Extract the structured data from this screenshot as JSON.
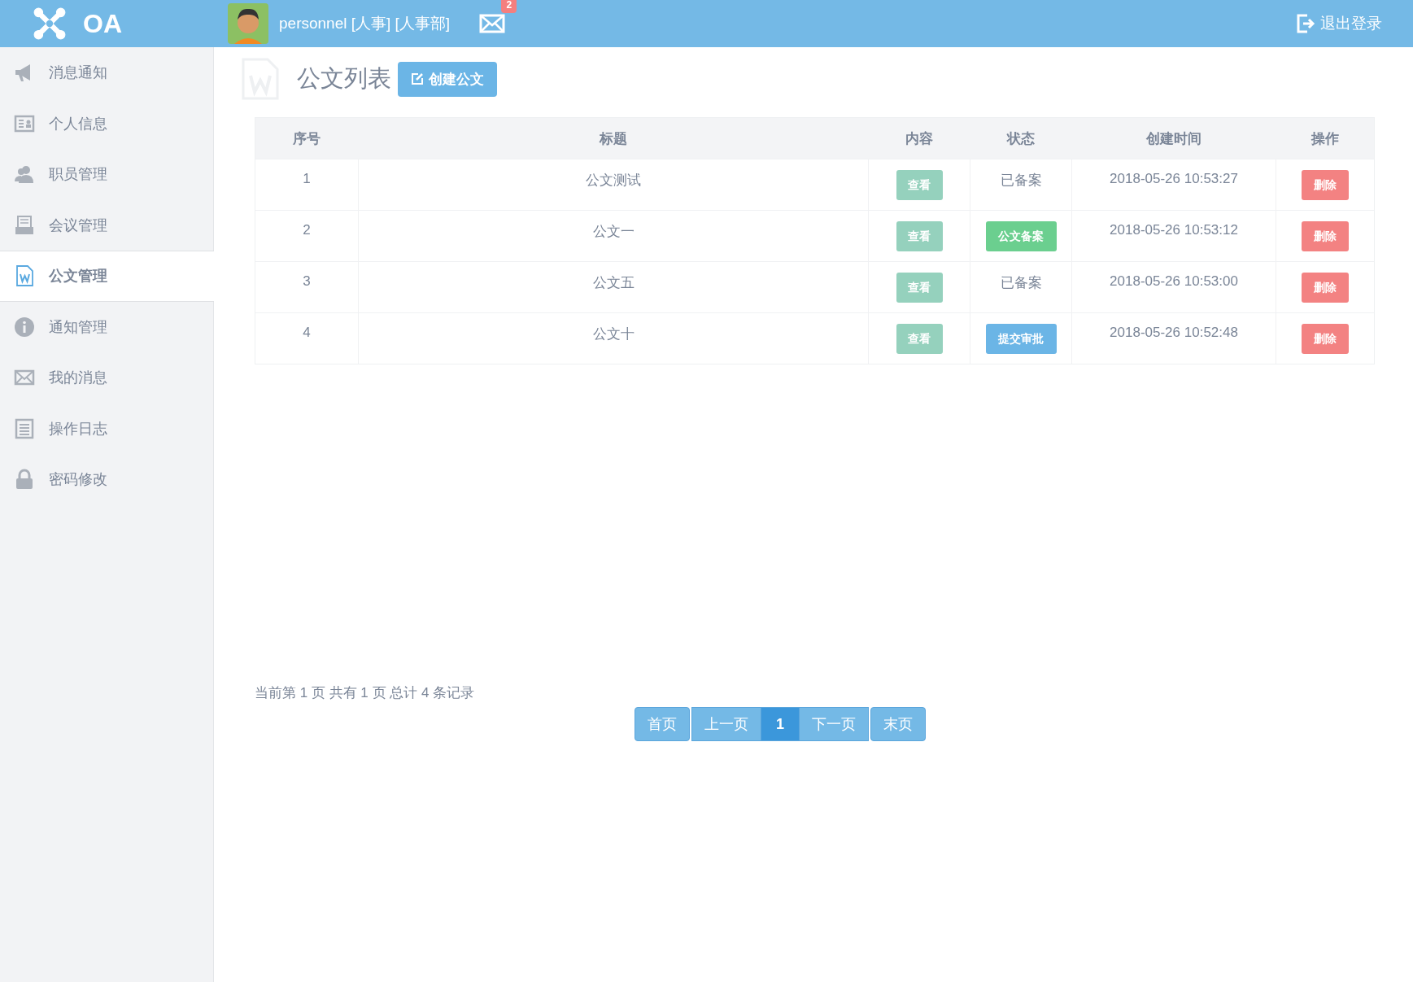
{
  "header": {
    "logo_text": "OA",
    "user": "personnel [人事] [人事部]",
    "mail_badge": "2",
    "logout": "退出登录"
  },
  "sidebar": {
    "items": [
      {
        "label": "消息通知",
        "selected": false
      },
      {
        "label": "个人信息",
        "selected": false
      },
      {
        "label": "职员管理",
        "selected": false
      },
      {
        "label": "会议管理",
        "selected": false
      },
      {
        "label": "公文管理",
        "selected": true
      },
      {
        "label": "通知管理",
        "selected": false
      },
      {
        "label": "我的消息",
        "selected": false
      },
      {
        "label": "操作日志",
        "selected": false
      },
      {
        "label": "密码修改",
        "selected": false
      }
    ]
  },
  "page": {
    "title": "公文列表",
    "create_button": "创建公文"
  },
  "table": {
    "columns": [
      "序号",
      "标题",
      "内容",
      "状态",
      "创建时间",
      "操作"
    ],
    "rows": [
      {
        "index": "1",
        "title": "公文测试",
        "view": "查看",
        "status": {
          "kind": "text",
          "label": "已备案"
        },
        "created": "2018-05-26 10:53:27",
        "delete": "删除"
      },
      {
        "index": "2",
        "title": "公文一",
        "view": "查看",
        "status": {
          "kind": "button",
          "label": "公文备案",
          "color": "#6bcf8f"
        },
        "created": "2018-05-26 10:53:12",
        "delete": "删除"
      },
      {
        "index": "3",
        "title": "公文五",
        "view": "查看",
        "status": {
          "kind": "text",
          "label": "已备案"
        },
        "created": "2018-05-26 10:53:00",
        "delete": "删除"
      },
      {
        "index": "4",
        "title": "公文十",
        "view": "查看",
        "status": {
          "kind": "button",
          "label": "提交审批",
          "color": "#6bb5e6"
        },
        "created": "2018-05-26 10:52:48",
        "delete": "删除"
      }
    ]
  },
  "pagination": {
    "summary": "当前第 1 页 共有 1 页 总计 4 条记录",
    "buttons": [
      {
        "label": "首页",
        "selected": false
      },
      {
        "label": "上一页",
        "selected": false
      },
      {
        "label": "1",
        "selected": true
      },
      {
        "label": "下一页",
        "selected": false
      },
      {
        "label": "末页",
        "selected": false
      }
    ]
  }
}
